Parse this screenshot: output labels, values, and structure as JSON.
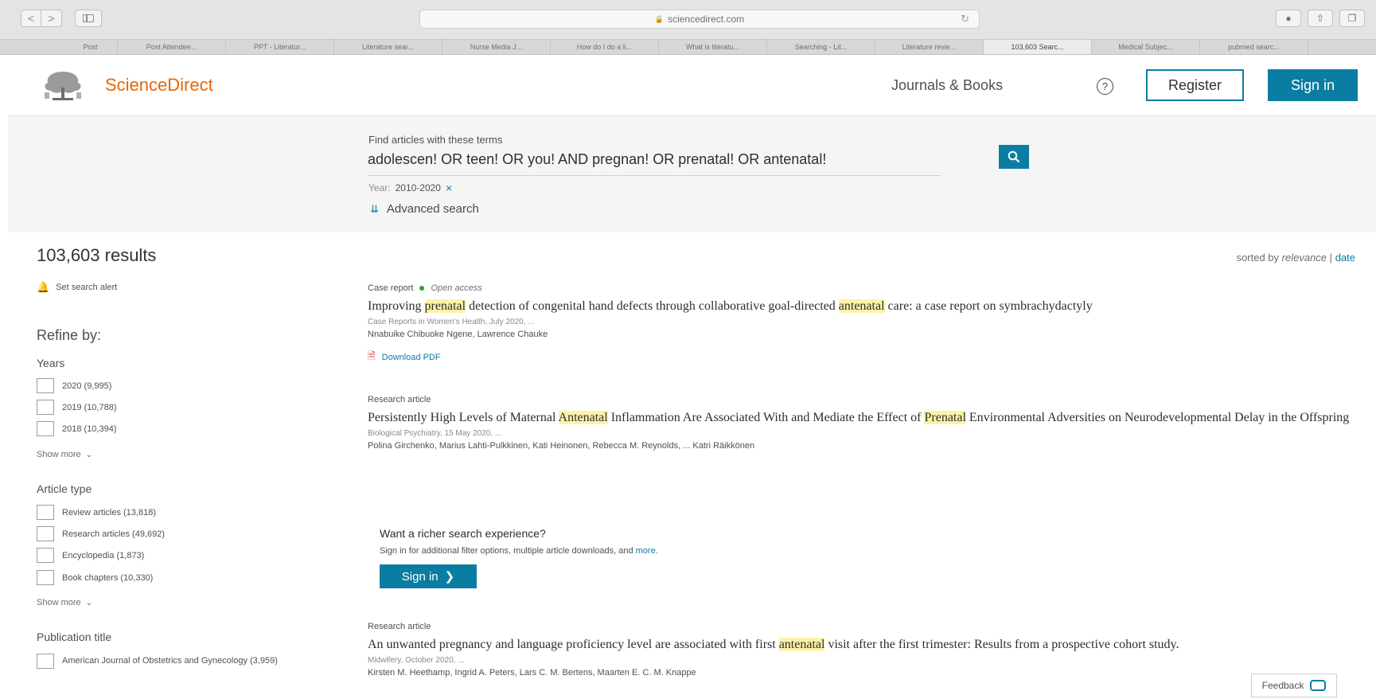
{
  "browser": {
    "address": "sciencedirect.com",
    "back_label": "<",
    "forward_label": ">",
    "tabs": [
      {
        "label": "Post"
      },
      {
        "label": "Post Attendee..."
      },
      {
        "label": "PPT - Literatur..."
      },
      {
        "label": "Literature sear..."
      },
      {
        "label": "Nurse Media J..."
      },
      {
        "label": "How do I do a li..."
      },
      {
        "label": "What is literatu..."
      },
      {
        "label": "Searching - Lit..."
      },
      {
        "label": "Literature revie..."
      },
      {
        "label": "103,603 Searc..."
      },
      {
        "label": "Medical Subjec..."
      },
      {
        "label": "pubmed searc..."
      }
    ]
  },
  "header": {
    "logo_text": "ScienceDirect",
    "journals_books": "Journals & Books",
    "help": "?",
    "register": "Register",
    "sign_in": "Sign in"
  },
  "search": {
    "label": "Find articles with these terms",
    "query": "adolescen! OR teen! OR you! AND pregnan! OR prenatal! OR antenatal!",
    "year_key": "Year:",
    "year_value": "2010-2020",
    "year_clear": "×",
    "advanced": "Advanced search"
  },
  "sidebar": {
    "results_count": "103,603 results",
    "set_alert": "Set search alert",
    "refine_by": "Refine by:",
    "years_title": "Years",
    "years": [
      {
        "label": "2020 (9,995)"
      },
      {
        "label": "2019 (10,788)"
      },
      {
        "label": "2018 (10,394)"
      }
    ],
    "show_more": "Show more",
    "article_type_title": "Article type",
    "article_types": [
      {
        "label": "Review articles (13,818)"
      },
      {
        "label": "Research articles (49,692)"
      },
      {
        "label": "Encyclopedia (1,873)"
      },
      {
        "label": "Book chapters (10,330)"
      }
    ],
    "publication_title": "Publication title",
    "publications": [
      {
        "label": "American Journal of Obstetrics and Gynecology (3,959)"
      }
    ]
  },
  "sort": {
    "prefix": "sorted by",
    "relevance": "relevance",
    "separator": "|",
    "date": "date"
  },
  "results": [
    {
      "type": "Case report",
      "open_access": "Open access",
      "title_parts": [
        "Improving ",
        "prenatal",
        " detection of congenital hand defects through collaborative goal-directed ",
        "antenatal",
        " care: a case report on symbrachydactyly"
      ],
      "source": "Case Reports in Women's Health, July 2020, ...",
      "authors": "Nnabuike Chibuoke Ngene, Lawrence Chauke",
      "download": "Download PDF"
    },
    {
      "type": "Research article",
      "title_parts": [
        "Persistently High Levels of Maternal ",
        "Antenatal",
        " Inflammation Are Associated With and Mediate the Effect of ",
        "Prenatal",
        " Environmental Adversities on Neurodevelopmental Delay in the Offspring"
      ],
      "source": "Biological Psychiatry, 15 May 2020, ...",
      "authors": "Polina Girchenko, Marius Lahti-Pulkkinen, Kati Heinonen, Rebecca M. Reynolds, ... Katri Räikkönen"
    },
    {
      "type": "Research article",
      "title_parts": [
        "An unwanted pregnancy and language proficiency level are associated with first ",
        "antenatal",
        " visit after the first trimester: Results from a prospective cohort study."
      ],
      "source": "Midwifery, October 2020, ...",
      "authors": "Kirsten M. Heethamp, Ingrid A. Peters, Lars C. M. Bertens, Maarten E. C. M. Knappe"
    }
  ],
  "promo": {
    "title": "Want a richer search experience?",
    "text": "Sign in for additional filter options, multiple article downloads, and",
    "more": "more.",
    "button": "Sign in"
  },
  "feedback": "Feedback",
  "colors": {
    "brand_orange": "#eb6500",
    "accent_blue": "#0c7da2",
    "highlight": "#fdf2a8",
    "open_access_green": "#29a61b"
  }
}
